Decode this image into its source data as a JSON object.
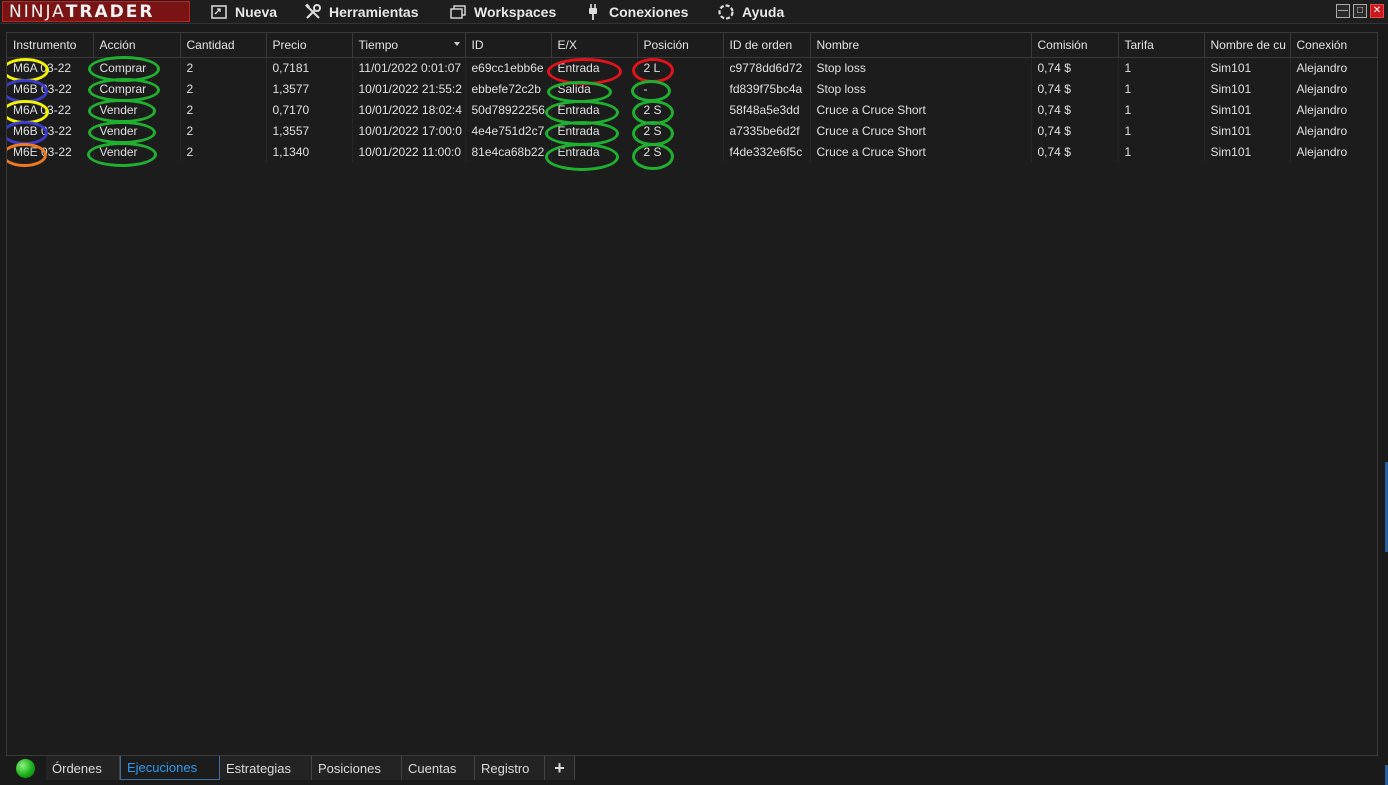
{
  "app": {
    "logo_light": "NINJA",
    "logo_bold": "TRADER"
  },
  "menu": [
    {
      "label": "Nueva",
      "icon": "new-window-icon"
    },
    {
      "label": "Herramientas",
      "icon": "tools-icon"
    },
    {
      "label": "Workspaces",
      "icon": "workspaces-icon"
    },
    {
      "label": "Conexiones",
      "icon": "plug-icon"
    },
    {
      "label": "Ayuda",
      "icon": "help-icon"
    }
  ],
  "table": {
    "columns": [
      "Instrumento",
      "Acción",
      "Cantidad",
      "Precio",
      "Tiempo",
      "ID",
      "E/X",
      "Posición",
      "ID de orden",
      "Nombre",
      "Comisión",
      "Tarifa",
      "Nombre de cu",
      "Conexión"
    ],
    "rows": [
      [
        "M6A 03-22",
        "Comprar",
        "2",
        "0,7181",
        "11/01/2022 0:01:07",
        "e69cc1ebb6e",
        "Entrada",
        "2 L",
        "c9778dd6d72",
        "Stop loss",
        "0,74 $",
        "1",
        "Sim101",
        "Alejandro"
      ],
      [
        "M6B 03-22",
        "Comprar",
        "2",
        "1,3577",
        "10/01/2022 21:55:2",
        "ebbefe72c2b",
        "Salida",
        "-",
        "fd839f75bc4a",
        "Stop loss",
        "0,74 $",
        "1",
        "Sim101",
        "Alejandro"
      ],
      [
        "M6A 03-22",
        "Vender",
        "2",
        "0,7170",
        "10/01/2022 18:02:4",
        "50d78922256",
        "Entrada",
        "2 S",
        "58f48a5e3dd",
        "Cruce a Cruce Short",
        "0,74 $",
        "1",
        "Sim101",
        "Alejandro"
      ],
      [
        "M6B 03-22",
        "Vender",
        "2",
        "1,3557",
        "10/01/2022 17:00:0",
        "4e4e751d2c7",
        "Entrada",
        "2 S",
        "a7335be6d2f",
        "Cruce a Cruce Short",
        "0,74 $",
        "1",
        "Sim101",
        "Alejandro"
      ],
      [
        "M6E 03-22",
        "Vender",
        "2",
        "1,1340",
        "10/01/2022 11:00:0",
        "81e4ca68b22",
        "Entrada",
        "2 S",
        "f4de332e6f5c",
        "Cruce a Cruce Short",
        "0,74 $",
        "1",
        "Sim101",
        "Alejandro"
      ]
    ]
  },
  "tabs": [
    {
      "label": "Órdenes",
      "active": false
    },
    {
      "label": "Ejecuciones",
      "active": true
    },
    {
      "label": "Estrategias",
      "active": false
    },
    {
      "label": "Posiciones",
      "active": false
    },
    {
      "label": "Cuentas",
      "active": false
    },
    {
      "label": "Registro",
      "active": false
    },
    {
      "label": "+",
      "active": false
    }
  ],
  "colors": {
    "logo_bg": "#7a1414",
    "active_tab": "#2b9bf0",
    "highlight_yellow": "#f4f400",
    "highlight_blue": "#3b3bd0",
    "highlight_orange": "#f07a20",
    "highlight_green": "#1fb030",
    "highlight_red": "#e0121a"
  }
}
